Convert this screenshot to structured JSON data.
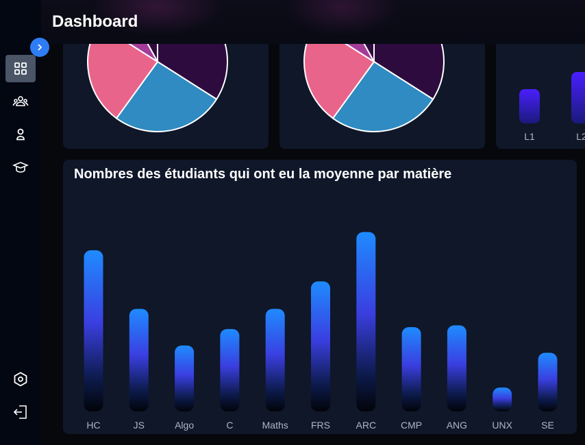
{
  "header": {
    "title": "Dashboard"
  },
  "sidebar": {
    "items": [
      {
        "name": "dashboard",
        "icon": "grid-icon",
        "active": true
      },
      {
        "name": "groups",
        "icon": "users-group-icon"
      },
      {
        "name": "profile",
        "icon": "user-icon"
      },
      {
        "name": "courses",
        "icon": "graduation-cap-icon"
      }
    ],
    "bottom": [
      {
        "name": "settings",
        "icon": "settings-hexagon-icon"
      },
      {
        "name": "logout",
        "icon": "logout-icon"
      }
    ],
    "expand_icon": "chevron-right-icon"
  },
  "colors": {
    "accent": "#2f7df5",
    "card_bg": "#0f1729",
    "pie_pink": "#e9648b",
    "pie_blue": "#2f8bc1",
    "pie_purple": "#2e0b3e",
    "pie_magenta": "#a43c9a",
    "bar_top": "#1f8bff",
    "bar_mid": "#3a3fe0",
    "bar_bottom": "#020409",
    "level_top": "#4a1fff",
    "level_bottom": "#1a1a7a"
  },
  "pie_charts": [
    {
      "slices": [
        {
          "color": "#2e0b3e",
          "value": 34
        },
        {
          "color": "#2f8bc1",
          "value": 26
        },
        {
          "color": "#e9648b",
          "value": 24
        },
        {
          "color": "#a43c9a",
          "value": 8
        },
        {
          "color": "#2e0b3e",
          "value": 8
        }
      ]
    },
    {
      "slices": [
        {
          "color": "#2e0b3e",
          "value": 34
        },
        {
          "color": "#2f8bc1",
          "value": 26
        },
        {
          "color": "#e9648b",
          "value": 24
        },
        {
          "color": "#a43c9a",
          "value": 8
        },
        {
          "color": "#2e0b3e",
          "value": 8
        }
      ]
    }
  ],
  "chart_data": [
    {
      "type": "bar",
      "title": "",
      "categories": [
        "L1",
        "L2"
      ],
      "values": [
        50,
        75
      ],
      "ylim": [
        0,
        100
      ]
    },
    {
      "type": "bar",
      "title": "Nombres des étudiants qui ont eu la moyenne par matière",
      "categories": [
        "HC",
        "JS",
        "Algo",
        "C",
        "Maths",
        "FRS",
        "ARC",
        "CMP",
        "ANG",
        "UNX",
        "SE"
      ],
      "values": [
        88,
        56,
        36,
        45,
        56,
        71,
        98,
        46,
        47,
        13,
        32
      ],
      "ylim": [
        0,
        100
      ],
      "xlabel": "",
      "ylabel": ""
    }
  ]
}
